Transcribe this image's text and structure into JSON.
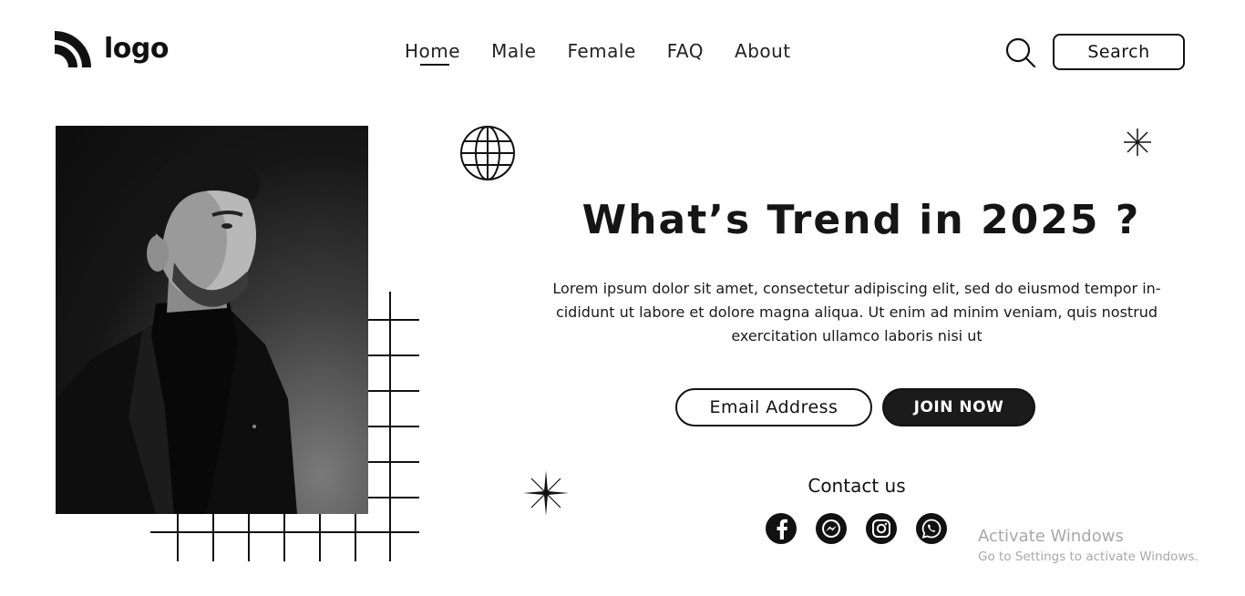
{
  "header": {
    "logo_text": "logo",
    "nav": [
      {
        "label": "Home",
        "active": true
      },
      {
        "label": "Male"
      },
      {
        "label": "Female"
      },
      {
        "label": "FAQ"
      },
      {
        "label": "About"
      }
    ],
    "search_label": "Search"
  },
  "hero": {
    "title": "What’s Trend in 2025 ?",
    "body": "Lorem ipsum dolor sit amet, consectetur adipiscing elit, sed do eiusmod tempor in-cididunt ut labore et dolore magna aliqua. Ut enim ad minim veniam, quis nostrud exercitation ullamco laboris nisi ut",
    "email_placeholder": "Email Address",
    "join_label": "JOIN NOW"
  },
  "contact": {
    "title": "Contact us",
    "icons": [
      "facebook-icon",
      "messenger-icon",
      "instagram-icon",
      "whatsapp-icon"
    ]
  },
  "watermark": {
    "title": "Activate Windows",
    "subtitle": "Go to Settings to activate Windows."
  },
  "colors": {
    "text": "#111111",
    "button_dark": "#1b1b1b",
    "background": "#ffffff",
    "watermark": "#a8a8a8"
  }
}
